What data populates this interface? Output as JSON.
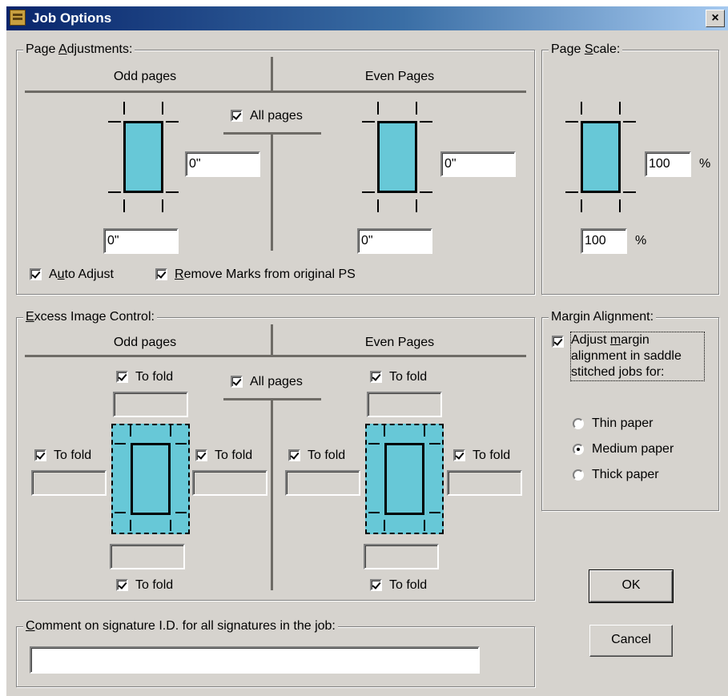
{
  "window": {
    "title": "Job Options",
    "close_label": "×"
  },
  "page_adjustments": {
    "legend_prefix": "Page ",
    "legend_key": "A",
    "legend_suffix": "djustments:",
    "odd_header": "Odd pages",
    "even_header": "Even Pages",
    "all_pages_label": "All pages",
    "all_pages_checked": true,
    "odd_right_value": "0\"",
    "odd_bottom_value": "0\"",
    "even_right_value": "0\"",
    "even_bottom_value": "0\"",
    "auto_adjust": {
      "pre": "A",
      "key": "u",
      "post": "to Adjust",
      "checked": true
    },
    "remove_marks": {
      "key": "R",
      "post": "emove Marks from original PS",
      "checked": true
    }
  },
  "page_scale": {
    "legend_prefix": "Page ",
    "legend_key": "S",
    "legend_suffix": "cale:",
    "horizontal_value": "100",
    "vertical_value": "100",
    "unit": "%"
  },
  "excess_image_control": {
    "legend_key": "E",
    "legend_suffix": "xcess Image Control:",
    "odd_header": "Odd pages",
    "even_header": "Even Pages",
    "all_pages_label": "All pages",
    "all_pages_checked": true,
    "to_fold_label": "To fold"
  },
  "margin_alignment": {
    "legend": "Margin Alignment:",
    "adjust_line1_pre": "Adjust ",
    "adjust_line1_key": "m",
    "adjust_line1_post": "argin",
    "adjust_line2": "alignment in saddle",
    "adjust_line3": "stitched jobs for:",
    "adjust_checked": true,
    "options": [
      "Thin paper",
      "Medium paper",
      "Thick paper"
    ],
    "selected": "Medium paper"
  },
  "comment": {
    "legend_key": "C",
    "legend_suffix": "omment on signature I.D. for all signatures in the job:",
    "value": ""
  },
  "buttons": {
    "ok": "OK",
    "cancel": "Cancel"
  }
}
